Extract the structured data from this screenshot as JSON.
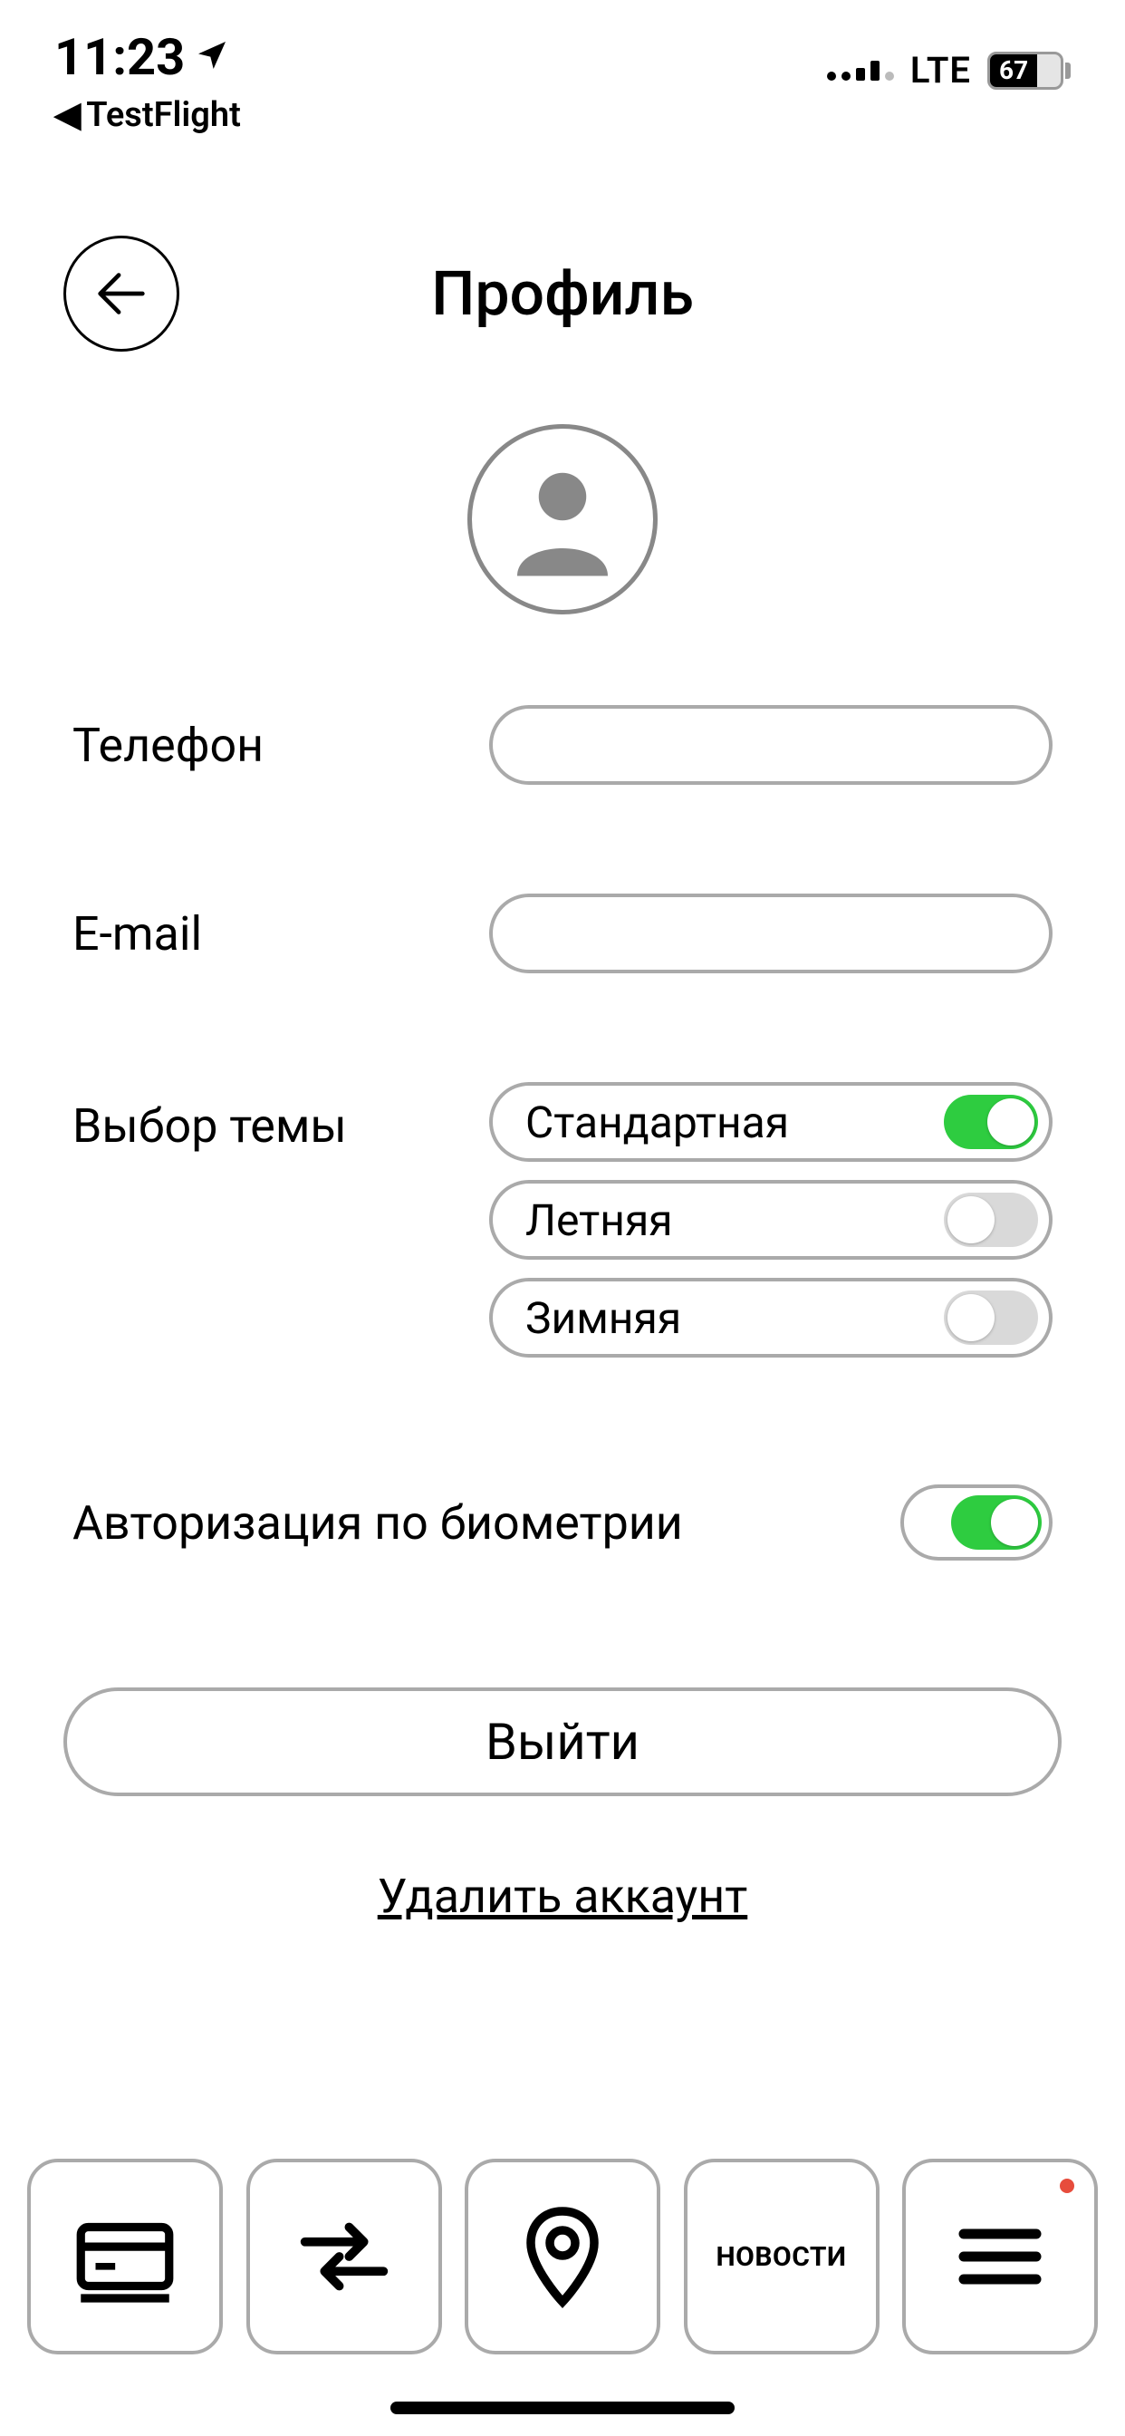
{
  "status": {
    "time": "11:23",
    "back_app": "TestFlight",
    "lte": "LTE",
    "battery_pct": "67"
  },
  "header": {
    "title": "Профиль"
  },
  "form": {
    "phone_label": "Телефон",
    "phone_value": "",
    "email_label": "E-mail",
    "email_value": "",
    "theme_label": "Выбор темы",
    "themes": {
      "standard": "Стандартная",
      "summer": "Летняя",
      "winter": "Зимняя"
    },
    "biometric_label": "Авторизация по биометрии"
  },
  "actions": {
    "logout": "Выйти",
    "delete": "Удалить аккаунт"
  },
  "nav": {
    "news_label": "НОВОСТИ"
  }
}
